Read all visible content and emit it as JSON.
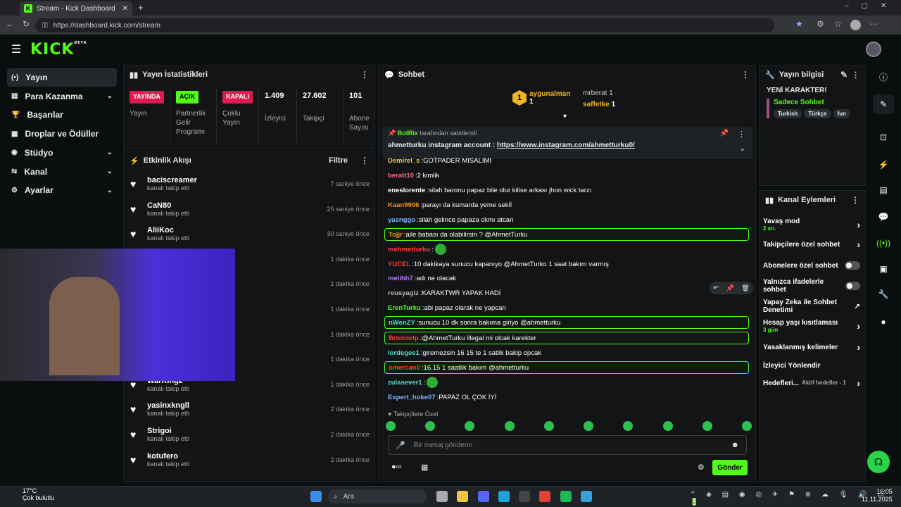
{
  "browser": {
    "tab_title": "Stream - Kick Dashboard",
    "url": "https://dashboard.kick.com/stream"
  },
  "header": {
    "logo": "KICK",
    "beta": "BETA"
  },
  "sidebar": {
    "items": [
      {
        "label": "Yayın",
        "icon": "broadcast-icon"
      },
      {
        "label": "Para Kazanma",
        "icon": "money-icon"
      },
      {
        "label": "Başarılar",
        "icon": "trophy-icon"
      },
      {
        "label": "Droplar ve Ödüller",
        "icon": "gift-icon"
      },
      {
        "label": "Stüdyo",
        "icon": "studio-icon"
      },
      {
        "label": "Kanal",
        "icon": "channel-icon"
      },
      {
        "label": "Ayarlar",
        "icon": "gear-icon"
      }
    ]
  },
  "stats": {
    "title": "Yayın İstatistikleri",
    "cols": [
      {
        "badge": "YAYINDA",
        "badge_color": "#e01a4f",
        "label": "Yayın"
      },
      {
        "badge": "AÇIK",
        "badge_color": "#53fc18",
        "label": "Partnerlik Gelir Programı"
      },
      {
        "badge": "KAPALI",
        "badge_color": "#e01a4f",
        "label": "Çoklu Yayın"
      },
      {
        "value": "1.409",
        "label": "İzleyici"
      },
      {
        "value": "27.602",
        "label": "Takipçi"
      },
      {
        "value": "101",
        "label": "Abone Sayısı"
      }
    ]
  },
  "activity": {
    "title": "Etkinlik Akışı",
    "filter": "Filtre",
    "rows": [
      {
        "name": "baciscreamer",
        "sub": "kanalı takip etti",
        "time": "7 saniye önce"
      },
      {
        "name": "CaN80",
        "sub": "kanalı takip etti",
        "time": "25 saniye önce"
      },
      {
        "name": "AliiKoc",
        "sub": "kanalı takip etti",
        "time": "30 saniye önce"
      },
      {
        "name": "",
        "sub": "",
        "time": "1 dakika önce"
      },
      {
        "name": "",
        "sub": "",
        "time": "1 dakika önce"
      },
      {
        "name": "",
        "sub": "",
        "time": "1 dakika önce"
      },
      {
        "name": "",
        "sub": "",
        "time": "1 dakika önce"
      },
      {
        "name": "",
        "sub": "",
        "time": "1 dakika önce"
      },
      {
        "name": "WarKing2",
        "sub": "kanalı takip etti",
        "time": "1 dakika önce"
      },
      {
        "name": "yasinxkngll",
        "sub": "kanalı takip etti",
        "time": "2 dakika önce"
      },
      {
        "name": "Strigoi",
        "sub": "kanalı takip etti",
        "time": "2 dakika önce"
      },
      {
        "name": "kotufero",
        "sub": "kanalı takip etti",
        "time": "2 dakika önce"
      }
    ]
  },
  "chat": {
    "title": "Sohbet",
    "top": [
      {
        "name": "aygunalman",
        "count": "1"
      },
      {
        "name": "mrberat",
        "count": "1"
      },
      {
        "name": "saffetke",
        "count": "1"
      }
    ],
    "pinned": {
      "by": "BotRix",
      "by_suffix": "tarafından sabitlendi",
      "text": "ahmetturku instagram account : ",
      "link": "https://www.instagram.com/ahmetturku0/"
    },
    "messages": [
      {
        "user": "Demirel_s",
        "color": "#f2c94c",
        "text": "GOTPADER MISALIMI",
        "hl": false
      },
      {
        "user": "beratt10",
        "color": "#ff6b8a",
        "text": "2 kimlik",
        "hl": false
      },
      {
        "user": "eneslorente",
        "color": "#ffffff",
        "text": "silah baronu papaz bile olur kilise arkası jhon wick tarzı",
        "hl": false
      },
      {
        "user": "Kaan9906",
        "color": "#f7931e",
        "text": "parayı da kumarda yeme seklİ",
        "hl": false
      },
      {
        "user": "yasnggo",
        "color": "#7fb2ff",
        "text": "silah gelince papaza ckmı atcan",
        "hl": false
      },
      {
        "user": "Tojjr",
        "color": "#f7931e",
        "text": "aile babası da olabilirsin ? @AhmetTurku",
        "hl": true
      },
      {
        "user": "mehmetturku",
        "color": "#ff3b3b",
        "text": "",
        "hl": false
      },
      {
        "user": "YUCEL",
        "color": "#ff3b3b",
        "text": "10 dakikaya sunucu kapanıyo @AhmetTurko 1 saat bakım varmış",
        "hl": false
      },
      {
        "user": "melihh7",
        "color": "#b57cff",
        "text": "adı ne olacak",
        "hl": false
      },
      {
        "user": "reusyagiz",
        "color": "#bbbbbb",
        "text": "KARAKTWR YAPAK HADİ",
        "hl": false
      },
      {
        "user": "ErenTurku",
        "color": "#53fc18",
        "text": "abi papaz olarak ne yapcan",
        "hl": false
      },
      {
        "user": "nWenZY",
        "color": "#4ee0c8",
        "text": "sunucu 10 dk sonra bakıma giriyo @ahmetturku",
        "hl": true
      },
      {
        "user": "Brndmrlp",
        "color": "#ff3b3b",
        "text": "@AhmetTurku illegal mi olcak karekter",
        "hl": true
      },
      {
        "user": "lordegee1",
        "color": "#4ee0c8",
        "text": "giremezsin 16 15 te 1 satlik bakip opcak",
        "hl": false
      },
      {
        "user": "omercan0",
        "color": "#ff3b3b",
        "text": "16.15 1 saatlik bakım @ahmetturku",
        "hl": true
      },
      {
        "user": "zulasever1",
        "color": "#4ee0c8",
        "text": "",
        "hl": false
      },
      {
        "user": "Expert_hoke07",
        "color": "#7fb2ff",
        "text": "PAPAZ OL ÇOK İYİ",
        "hl": false
      }
    ],
    "followers_only": "Takipçilere Özel",
    "input_placeholder": "Bir mesaj gönderin",
    "send": "Gönder"
  },
  "stream_info": {
    "title": "Yayın bilgisi",
    "stream_title": "YENİ KARAKTER!",
    "subonly": "Sadece Sohbet",
    "tags": [
      "Turkish",
      "Türkçe",
      "fun"
    ]
  },
  "channel_actions": {
    "title": "Kanal Eylemleri",
    "items": [
      {
        "label": "Yavaş mod",
        "sub": "2 sn.",
        "type": "chev"
      },
      {
        "label": "Takipçilere özel sohbet",
        "sub": "",
        "type": "chev"
      },
      {
        "label": "Abonelere özel sohbet",
        "sub": "",
        "type": "toggle"
      },
      {
        "label": "Yalnızca ifadelerle sohbet",
        "sub": "",
        "type": "toggle"
      },
      {
        "label": "Yapay Zeka ile Sohbet Denetimi",
        "sub": "",
        "type": "ext"
      },
      {
        "label": "Hesap yaşı kısıtlaması",
        "sub": "3 gün",
        "type": "chev"
      },
      {
        "label": "Yasaklanmış kelimeler",
        "sub": "",
        "type": "chev"
      },
      {
        "label": "İzleyici Yönlendir",
        "sub": "",
        "type": "none"
      },
      {
        "label": "Hedefleri...",
        "sub": "Aktif hedefler - 1",
        "type": "chev"
      }
    ]
  },
  "taskbar": {
    "weather_temp": "17°C",
    "weather_desc": "Çok bulutlu",
    "search": "Ara",
    "time": "16:05",
    "date": "11.11.2025"
  }
}
